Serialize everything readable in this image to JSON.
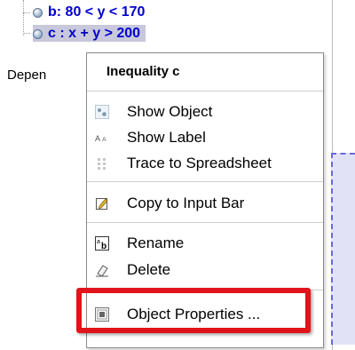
{
  "algebra": {
    "row_b": "b: 80 < y < 170",
    "row_c": "c : x + y > 200",
    "dependent_label": "Depen"
  },
  "context_menu": {
    "title": "Inequality c",
    "items": [
      {
        "label": "Show Object",
        "icon": "show-object-icon"
      },
      {
        "label": "Show Label",
        "icon": "show-label-icon"
      },
      {
        "label": "Trace to Spreadsheet",
        "icon": "trace-spreadsheet-icon"
      },
      {
        "label": "Copy to Input Bar",
        "icon": "copy-input-bar-icon"
      },
      {
        "label": "Rename",
        "icon": "rename-icon"
      },
      {
        "label": "Delete",
        "icon": "delete-icon"
      },
      {
        "label": "Object Properties ...",
        "icon": "object-properties-icon"
      }
    ]
  },
  "colors": {
    "object_text": "#0000cc",
    "selection": "#c8c8dc",
    "highlight": "#e0141a",
    "graph_fill": "#e2e2f6"
  }
}
